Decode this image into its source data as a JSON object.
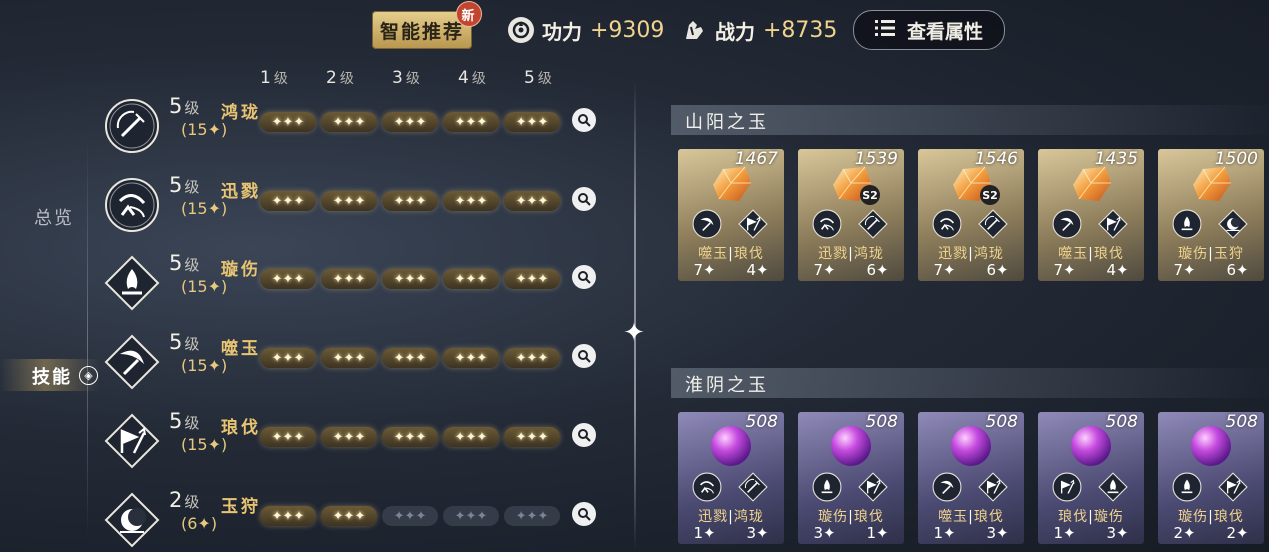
{
  "topbar": {
    "smart_label": "智能推荐",
    "new_badge": "新",
    "gongli_label": "功力",
    "gongli_value": "+9309",
    "zhanli_label": "战力",
    "zhanli_value": "+8735",
    "attr_label": "查看属性"
  },
  "levels": [
    "1",
    "2",
    "3",
    "4",
    "5"
  ],
  "level_suffix": "级",
  "nav": {
    "overview": "总览",
    "skill": "技能"
  },
  "skills": [
    {
      "level": "5",
      "name": "鸿珑",
      "points": "(15✦)",
      "filled": 5,
      "icon": "sword-circle-icon"
    },
    {
      "level": "5",
      "name": "迅戮",
      "points": "(15✦)",
      "filled": 5,
      "icon": "swift-slash-icon"
    },
    {
      "level": "5",
      "name": "璇伤",
      "points": "(15✦)",
      "filled": 5,
      "icon": "flame-diamond-icon"
    },
    {
      "level": "5",
      "name": "噬玉",
      "points": "(15✦)",
      "filled": 5,
      "icon": "crescent-strike-icon"
    },
    {
      "level": "5",
      "name": "琅伐",
      "points": "(15✦)",
      "filled": 5,
      "icon": "banner-arrow-icon"
    },
    {
      "level": "2",
      "name": "玉狩",
      "points": "(6✦)",
      "filled": 2,
      "icon": "moon-hunt-icon"
    }
  ],
  "sections": [
    {
      "title": "山阳之玉",
      "tone": "gold",
      "cards": [
        {
          "score": "1467",
          "s2": false,
          "names": [
            "噬玉",
            "琅伐"
          ],
          "stars": [
            "7✦",
            "4✦"
          ]
        },
        {
          "score": "1539",
          "s2": true,
          "names": [
            "迅戮",
            "鸿珑"
          ],
          "stars": [
            "7✦",
            "6✦"
          ]
        },
        {
          "score": "1546",
          "s2": true,
          "names": [
            "迅戮",
            "鸿珑"
          ],
          "stars": [
            "7✦",
            "6✦"
          ]
        },
        {
          "score": "1435",
          "s2": false,
          "names": [
            "噬玉",
            "琅伐"
          ],
          "stars": [
            "7✦",
            "4✦"
          ]
        },
        {
          "score": "1500",
          "s2": false,
          "names": [
            "璇伤",
            "玉狩"
          ],
          "stars": [
            "7✦",
            "6✦"
          ]
        }
      ]
    },
    {
      "title": "淮阴之玉",
      "tone": "violet",
      "cards": [
        {
          "score": "508",
          "s2": false,
          "names": [
            "迅戮",
            "鸿珑"
          ],
          "stars": [
            "1✦",
            "3✦"
          ]
        },
        {
          "score": "508",
          "s2": false,
          "names": [
            "璇伤",
            "琅伐"
          ],
          "stars": [
            "3✦",
            "1✦"
          ]
        },
        {
          "score": "508",
          "s2": false,
          "names": [
            "噬玉",
            "琅伐"
          ],
          "stars": [
            "1✦",
            "3✦"
          ]
        },
        {
          "score": "508",
          "s2": false,
          "names": [
            "琅伐",
            "璇伤"
          ],
          "stars": [
            "1✦",
            "3✦"
          ]
        },
        {
          "score": "508",
          "s2": false,
          "names": [
            "璇伤",
            "琅伐"
          ],
          "stars": [
            "2✦",
            "2✦"
          ]
        }
      ]
    }
  ],
  "s2_label": "S2",
  "colors": {
    "gold": "#f0d48e",
    "accent_name": "#e9c572"
  }
}
